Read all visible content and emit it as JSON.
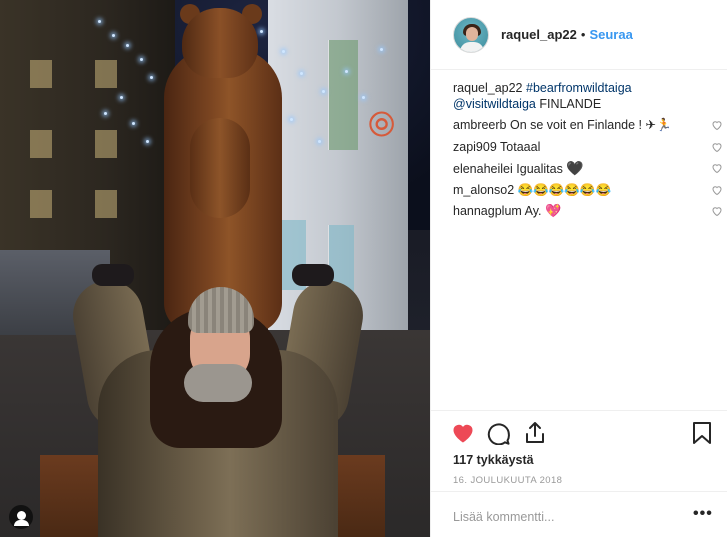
{
  "post": {
    "username": "raquel_ap22",
    "separator": "•",
    "follow_label": "Seuraa"
  },
  "caption": {
    "username": "raquel_ap22",
    "hashtag": "#bearfromwildtaiga",
    "mention": "@visitwildtaiga",
    "text": "FINLANDE"
  },
  "comments": [
    {
      "username": "ambreerb",
      "text": "On se voit en Finlande !",
      "suffix": "✈🏃"
    },
    {
      "username": "zapi909",
      "text": "Totaaal",
      "suffix": ""
    },
    {
      "username": "elenaheilei",
      "text": "Igualitas",
      "suffix": "🖤"
    },
    {
      "username": "m_alonso2",
      "text": "",
      "suffix": "😂😂😂😂😂😂"
    },
    {
      "username": "hannagplum",
      "text": "Ay.",
      "suffix": "💖"
    }
  ],
  "stats": {
    "likes": "117 tykkäystä",
    "date": "16. JOULUKUUTA 2018"
  },
  "comment_box": {
    "placeholder": "Lisää kommentti...",
    "more": "•••"
  },
  "icons": {
    "like": "heart-filled-icon",
    "comment": "comment-bubble-icon",
    "share": "share-icon",
    "save": "bookmark-icon",
    "comment_like": "heart-outline-icon",
    "user_tag": "user-tag-icon"
  },
  "colors": {
    "link": "#3897f0",
    "hashtag": "#003569",
    "like_red": "#ed4956",
    "muted": "#999999"
  }
}
